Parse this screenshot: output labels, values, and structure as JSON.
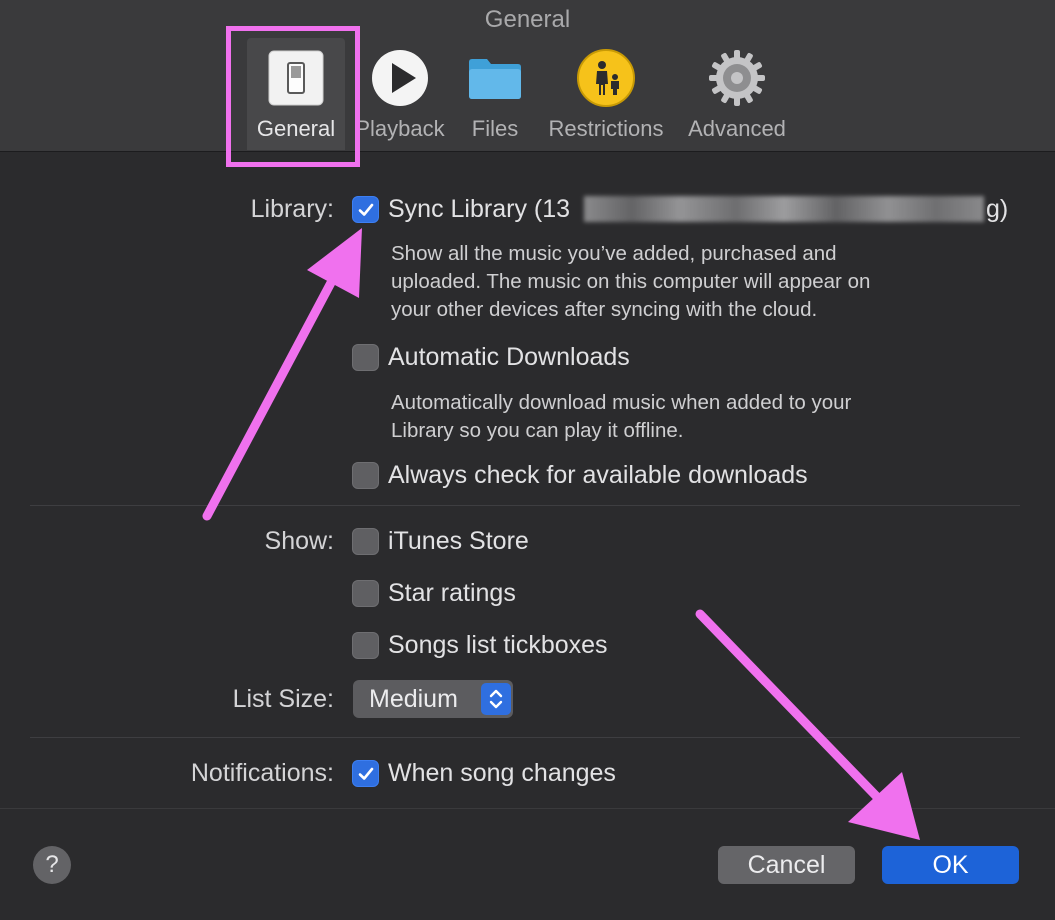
{
  "window": {
    "title": "General"
  },
  "toolbar": {
    "tabs": [
      {
        "label": "General",
        "icon": "switch-icon",
        "selected": true
      },
      {
        "label": "Playback",
        "icon": "play-icon",
        "selected": false
      },
      {
        "label": "Files",
        "icon": "folder-icon",
        "selected": false
      },
      {
        "label": "Restrictions",
        "icon": "parental-controls-icon",
        "selected": false
      },
      {
        "label": "Advanced",
        "icon": "gear-icon",
        "selected": false
      }
    ]
  },
  "library": {
    "label": "Library:",
    "sync": {
      "text_start": "Sync Library (13",
      "text_end": "g)",
      "checked": true,
      "description": [
        "Show all the music you’ve added, purchased and",
        "uploaded. The music on this computer will appear on",
        "your other devices after syncing with the cloud."
      ]
    },
    "auto_downloads": {
      "label": "Automatic Downloads",
      "checked": false,
      "description": [
        "Automatically download music when added to your",
        "Library so you can play it offline."
      ]
    },
    "always_check": {
      "label": "Always check for available downloads",
      "checked": false
    }
  },
  "show": {
    "label": "Show:",
    "items": [
      {
        "label": "iTunes Store",
        "checked": false
      },
      {
        "label": "Star ratings",
        "checked": false
      },
      {
        "label": "Songs list tickboxes",
        "checked": false
      }
    ]
  },
  "list_size": {
    "label": "List Size:",
    "value": "Medium"
  },
  "notifications": {
    "label": "Notifications:",
    "option": "When song changes",
    "checked": true
  },
  "footer": {
    "help": "?",
    "cancel": "Cancel",
    "ok": "OK"
  },
  "colors": {
    "background": "#2b2b2d",
    "toolbar": "#3a3a3c",
    "accent_blue": "#1d63d8",
    "annotation_pink": "#f071ee"
  }
}
